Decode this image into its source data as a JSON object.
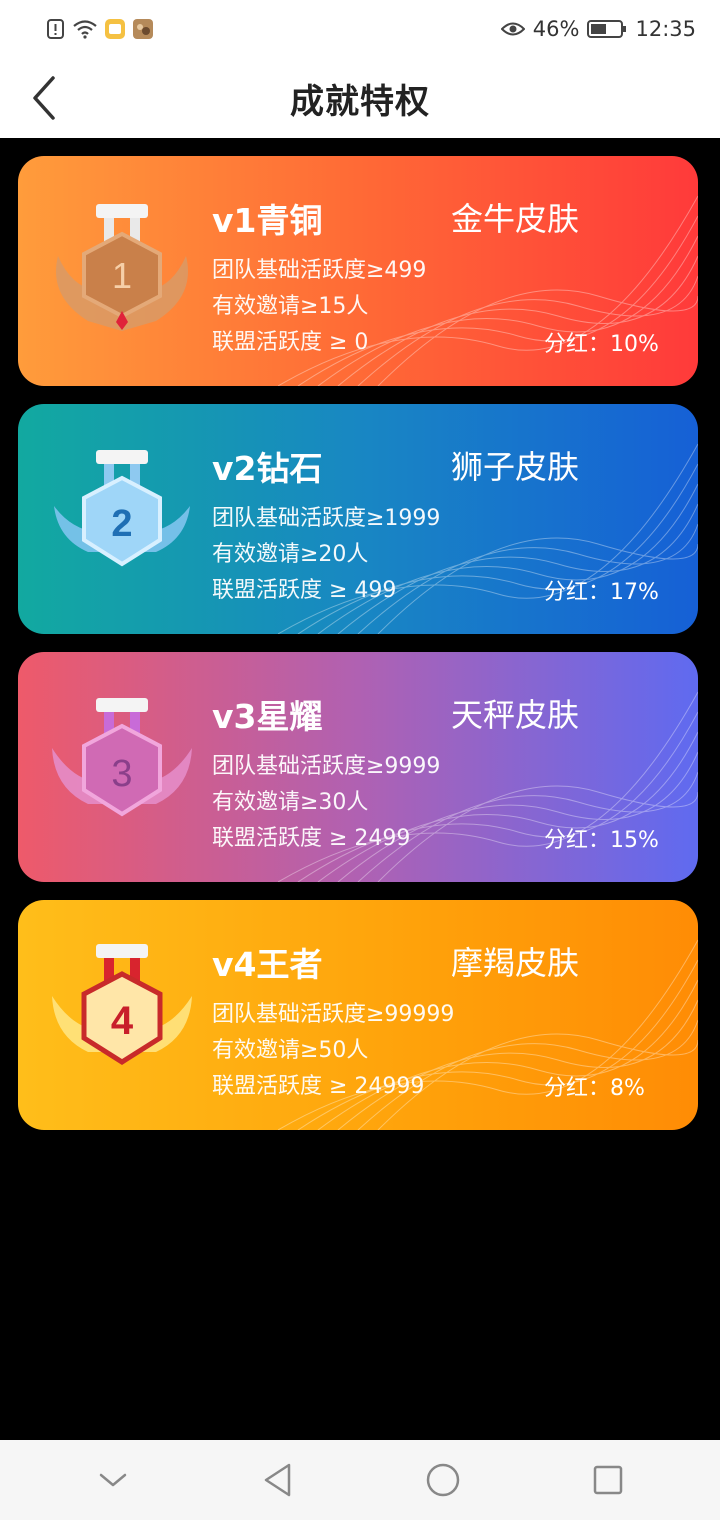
{
  "status_bar": {
    "battery_percent": "46%",
    "time": "12:35"
  },
  "header": {
    "title": "成就特权"
  },
  "cards": [
    {
      "level": "v1青铜",
      "skin": "金牛皮肤",
      "req_team": "团队基础活跃度≥499",
      "req_invite": "有效邀请≥15人",
      "req_alliance": "联盟活跃度 ≥ 0",
      "share": "分红：10%",
      "medal_number": "1"
    },
    {
      "level": "v2钻石",
      "skin": "狮子皮肤",
      "req_team": "团队基础活跃度≥1999",
      "req_invite": "有效邀请≥20人",
      "req_alliance": "联盟活跃度 ≥ 499",
      "share": "分红：17%",
      "medal_number": "2"
    },
    {
      "level": "v3星耀",
      "skin": "天秤皮肤",
      "req_team": "团队基础活跃度≥9999",
      "req_invite": "有效邀请≥30人",
      "req_alliance": "联盟活跃度 ≥ 2499",
      "share": "分红：15%",
      "medal_number": "3"
    },
    {
      "level": "v4王者",
      "skin": "摩羯皮肤",
      "req_team": "团队基础活跃度≥99999",
      "req_invite": "有效邀请≥50人",
      "req_alliance": "联盟活跃度 ≥ 24999",
      "share": "分红：8%",
      "medal_number": "4"
    }
  ],
  "icons": {
    "back": "chevron-left-icon",
    "nav_hide": "chevron-down-icon",
    "nav_back": "triangle-back-icon",
    "nav_home": "circle-home-icon",
    "nav_recent": "square-recent-icon"
  },
  "colors": {
    "card1": "#ff6a36",
    "card2": "#1887c3",
    "card3": "#b061b2",
    "card4": "#ffa10a"
  }
}
